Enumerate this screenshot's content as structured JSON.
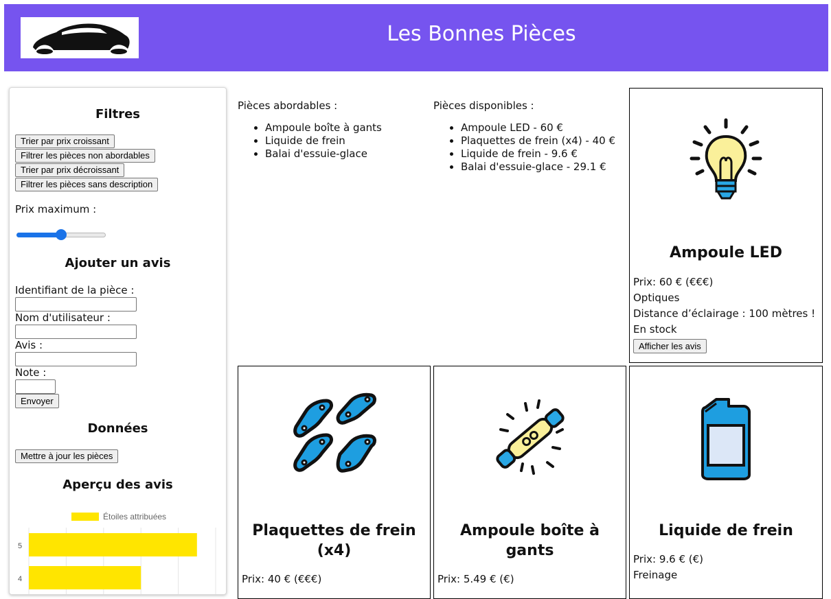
{
  "header": {
    "title": "Les Bonnes Pièces",
    "logo": "car-silhouette-logo"
  },
  "sidebar": {
    "filters_title": "Filtres",
    "buttons": {
      "sort_asc": "Trier par prix croissant",
      "filter_affordable": "Filtrer les pièces non abordables",
      "sort_desc": "Trier par prix décroissant",
      "filter_no_desc": "Filtrer les pièces sans description"
    },
    "price_max_label": "Prix maximum :",
    "price_slider_fraction": 0.5,
    "review_title": "Ajouter un avis",
    "fields": {
      "piece_id": "Identifiant de la pièce :",
      "username": "Nom d'utilisateur :",
      "review": "Avis :",
      "rating": "Note :"
    },
    "send_button": "Envoyer",
    "data_title": "Données",
    "update_button": "Mettre à jour les pièces",
    "overview_title": "Aperçu des avis"
  },
  "chart_data": {
    "type": "bar",
    "orientation": "horizontal",
    "legend": "Étoiles attribuées",
    "legend_position": "top",
    "categories": [
      "5",
      "4"
    ],
    "values": [
      45,
      30
    ],
    "color": "#ffe500",
    "grid": true
  },
  "affordable": {
    "title": "Pièces abordables :",
    "items": [
      "Ampoule boîte à gants",
      "Liquide de frein",
      "Balai d'essuie-glace"
    ]
  },
  "available": {
    "title": "Pièces disponibles :",
    "items": [
      "Ampoule LED - 60 €",
      "Plaquettes de frein (x4) - 40 €",
      "Liquide de frein - 9.6 €",
      "Balai d'essuie-glace - 29.1 €"
    ]
  },
  "cards": {
    "led": {
      "name": "Ampoule LED",
      "icon": "light-bulb-icon",
      "price": "Prix: 60 € (€€€)",
      "category": "Optiques",
      "description": "Distance d’éclairage : 100 mètres !",
      "stock": "En stock",
      "button": "Afficher les avis"
    },
    "plaquettes": {
      "name": "Plaquettes de frein (x4)",
      "icon": "brake-pads-icon",
      "price": "Prix: 40 € (€€€)"
    },
    "ampoule_gants": {
      "name": "Ampoule boîte à gants",
      "icon": "glovebox-bulb-icon",
      "price": "Prix: 5.49 € (€)"
    },
    "liquide": {
      "name": "Liquide de frein",
      "icon": "fluid-bottle-icon",
      "price": "Prix: 9.6 € (€)",
      "category": "Freinage"
    }
  }
}
